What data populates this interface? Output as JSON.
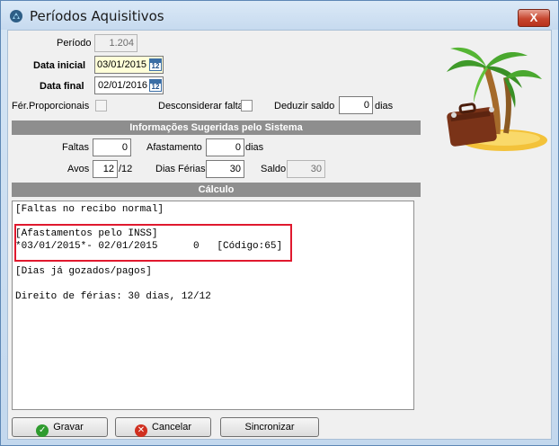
{
  "window": {
    "title": "Períodos Aquisitivos",
    "close_label": "X"
  },
  "form": {
    "periodo_label": "Período",
    "periodo_value": "1.204",
    "data_inicial_label": "Data inicial",
    "data_inicial_value": "03/01/2015",
    "data_final_label": "Data final",
    "data_final_value": "02/01/2016",
    "calendar_glyph": "12",
    "fer_proporcionais_label": "Fér.Proporcionais",
    "desconsiderar_faltas_label": "Desconsiderar faltas",
    "deduzir_saldo_label": "Deduzir saldo",
    "deduzir_saldo_value": "0",
    "deduzir_saldo_unit": "dias"
  },
  "sugeridas": {
    "header": "Informações Sugeridas pelo Sistema",
    "faltas_label": "Faltas",
    "faltas_value": "0",
    "afastamento_label": "Afastamento",
    "afastamento_value": "0",
    "afastamento_unit": "dias",
    "avos_label": "Avos",
    "avos_value": "12",
    "avos_unit": "/12",
    "dias_ferias_label": "Dias Férias",
    "dias_ferias_value": "30",
    "saldo_label": "Saldo",
    "saldo_value": "30"
  },
  "calculo": {
    "header": "Cálculo",
    "lines": [
      "[Faltas no recibo normal]",
      "",
      "[Afastamentos pelo INSS]",
      "*03/01/2015*- 02/01/2015      0   [Código:65]",
      "",
      "[Dias já gozados/pagos]",
      "",
      "Direito de férias: 30 dias, 12/12"
    ]
  },
  "buttons": {
    "gravar": "Gravar",
    "cancelar": "Cancelar",
    "sincronizar": "Sincronizar"
  },
  "icons": {
    "title": "app-icon",
    "gravar": "check-icon",
    "cancelar": "cancel-icon",
    "calendar": "calendar-icon",
    "illustration": "palm-tree-suitcase-icon"
  },
  "colors": {
    "section_bg": "#8e8e8e",
    "highlight_border": "#e0192e",
    "date_field_bg": "#ffffd8"
  }
}
